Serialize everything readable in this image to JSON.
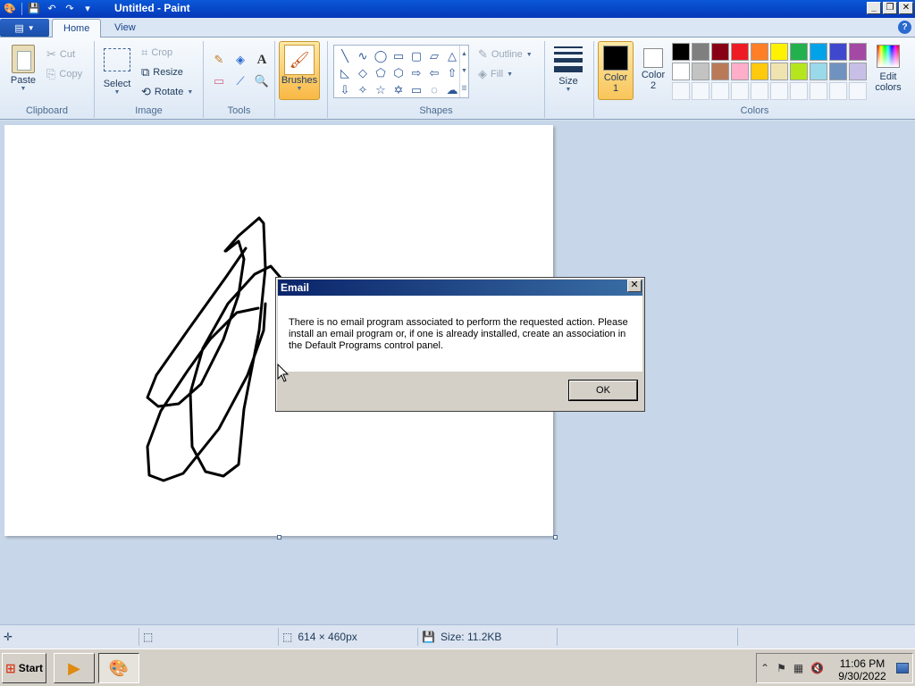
{
  "window": {
    "title": "Untitled - Paint",
    "controls": [
      "minimize",
      "restore",
      "close"
    ]
  },
  "tabs": [
    {
      "label": "Home",
      "active": true
    },
    {
      "label": "View",
      "active": false
    }
  ],
  "ribbon": {
    "clipboard": {
      "label": "Clipboard",
      "paste": "Paste",
      "cut": "Cut",
      "copy": "Copy"
    },
    "image": {
      "label": "Image",
      "select": "Select",
      "crop": "Crop",
      "resize": "Resize",
      "rotate": "Rotate"
    },
    "tools": {
      "label": "Tools",
      "brushes": "Brushes"
    },
    "shapes": {
      "label": "Shapes",
      "outline": "Outline",
      "fill": "Fill"
    },
    "size": {
      "label": "Size"
    },
    "colors": {
      "label": "Colors",
      "color1": "Color 1",
      "color2": "Color 2",
      "edit": "Edit colors",
      "color1_value": "#000000",
      "color2_value": "#ffffff",
      "palette_row1": [
        "#000000",
        "#7f7f7f",
        "#880015",
        "#ed1c24",
        "#ff7f27",
        "#fff200",
        "#22b14c",
        "#00a2e8",
        "#3f48cc",
        "#a349a4"
      ],
      "palette_row2": [
        "#ffffff",
        "#c3c3c3",
        "#b97a57",
        "#ffaec9",
        "#ffc90e",
        "#efe4b0",
        "#b5e61d",
        "#99d9ea",
        "#7092be",
        "#c8bfe7"
      ]
    }
  },
  "dialog": {
    "title": "Email",
    "message": "There is no email program associated to perform the requested action. Please install an email program or, if one is already installed, create an association in the Default Programs control panel.",
    "ok": "OK"
  },
  "statusbar": {
    "dimensions": "614 × 460px",
    "size": "Size: 11.2KB"
  },
  "taskbar": {
    "start": "Start",
    "time": "11:06 PM",
    "date": "9/30/2022"
  }
}
